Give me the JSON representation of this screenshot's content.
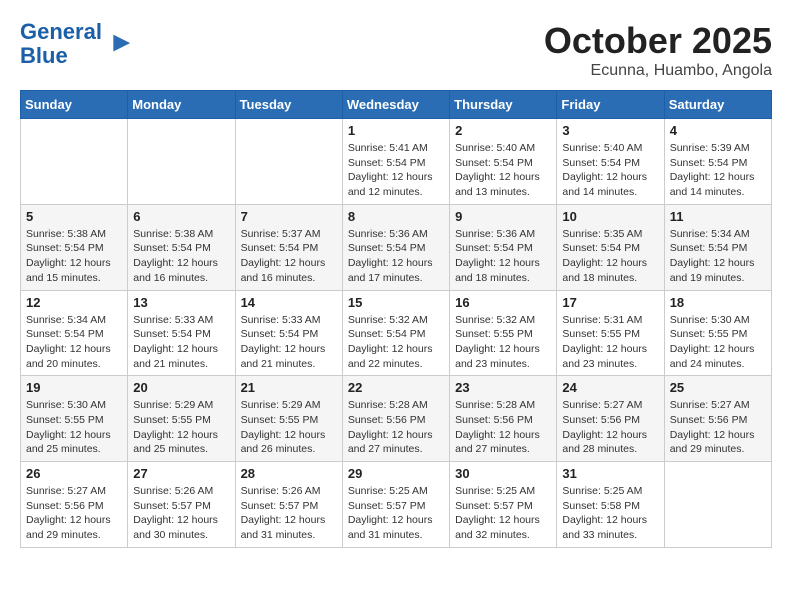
{
  "header": {
    "logo_line1": "General",
    "logo_line2": "Blue",
    "month": "October 2025",
    "location": "Ecunna, Huambo, Angola"
  },
  "weekdays": [
    "Sunday",
    "Monday",
    "Tuesday",
    "Wednesday",
    "Thursday",
    "Friday",
    "Saturday"
  ],
  "weeks": [
    [
      {
        "day": "",
        "info": ""
      },
      {
        "day": "",
        "info": ""
      },
      {
        "day": "",
        "info": ""
      },
      {
        "day": "1",
        "info": "Sunrise: 5:41 AM\nSunset: 5:54 PM\nDaylight: 12 hours and 12 minutes."
      },
      {
        "day": "2",
        "info": "Sunrise: 5:40 AM\nSunset: 5:54 PM\nDaylight: 12 hours and 13 minutes."
      },
      {
        "day": "3",
        "info": "Sunrise: 5:40 AM\nSunset: 5:54 PM\nDaylight: 12 hours and 14 minutes."
      },
      {
        "day": "4",
        "info": "Sunrise: 5:39 AM\nSunset: 5:54 PM\nDaylight: 12 hours and 14 minutes."
      }
    ],
    [
      {
        "day": "5",
        "info": "Sunrise: 5:38 AM\nSunset: 5:54 PM\nDaylight: 12 hours and 15 minutes."
      },
      {
        "day": "6",
        "info": "Sunrise: 5:38 AM\nSunset: 5:54 PM\nDaylight: 12 hours and 16 minutes."
      },
      {
        "day": "7",
        "info": "Sunrise: 5:37 AM\nSunset: 5:54 PM\nDaylight: 12 hours and 16 minutes."
      },
      {
        "day": "8",
        "info": "Sunrise: 5:36 AM\nSunset: 5:54 PM\nDaylight: 12 hours and 17 minutes."
      },
      {
        "day": "9",
        "info": "Sunrise: 5:36 AM\nSunset: 5:54 PM\nDaylight: 12 hours and 18 minutes."
      },
      {
        "day": "10",
        "info": "Sunrise: 5:35 AM\nSunset: 5:54 PM\nDaylight: 12 hours and 18 minutes."
      },
      {
        "day": "11",
        "info": "Sunrise: 5:34 AM\nSunset: 5:54 PM\nDaylight: 12 hours and 19 minutes."
      }
    ],
    [
      {
        "day": "12",
        "info": "Sunrise: 5:34 AM\nSunset: 5:54 PM\nDaylight: 12 hours and 20 minutes."
      },
      {
        "day": "13",
        "info": "Sunrise: 5:33 AM\nSunset: 5:54 PM\nDaylight: 12 hours and 21 minutes."
      },
      {
        "day": "14",
        "info": "Sunrise: 5:33 AM\nSunset: 5:54 PM\nDaylight: 12 hours and 21 minutes."
      },
      {
        "day": "15",
        "info": "Sunrise: 5:32 AM\nSunset: 5:54 PM\nDaylight: 12 hours and 22 minutes."
      },
      {
        "day": "16",
        "info": "Sunrise: 5:32 AM\nSunset: 5:55 PM\nDaylight: 12 hours and 23 minutes."
      },
      {
        "day": "17",
        "info": "Sunrise: 5:31 AM\nSunset: 5:55 PM\nDaylight: 12 hours and 23 minutes."
      },
      {
        "day": "18",
        "info": "Sunrise: 5:30 AM\nSunset: 5:55 PM\nDaylight: 12 hours and 24 minutes."
      }
    ],
    [
      {
        "day": "19",
        "info": "Sunrise: 5:30 AM\nSunset: 5:55 PM\nDaylight: 12 hours and 25 minutes."
      },
      {
        "day": "20",
        "info": "Sunrise: 5:29 AM\nSunset: 5:55 PM\nDaylight: 12 hours and 25 minutes."
      },
      {
        "day": "21",
        "info": "Sunrise: 5:29 AM\nSunset: 5:55 PM\nDaylight: 12 hours and 26 minutes."
      },
      {
        "day": "22",
        "info": "Sunrise: 5:28 AM\nSunset: 5:56 PM\nDaylight: 12 hours and 27 minutes."
      },
      {
        "day": "23",
        "info": "Sunrise: 5:28 AM\nSunset: 5:56 PM\nDaylight: 12 hours and 27 minutes."
      },
      {
        "day": "24",
        "info": "Sunrise: 5:27 AM\nSunset: 5:56 PM\nDaylight: 12 hours and 28 minutes."
      },
      {
        "day": "25",
        "info": "Sunrise: 5:27 AM\nSunset: 5:56 PM\nDaylight: 12 hours and 29 minutes."
      }
    ],
    [
      {
        "day": "26",
        "info": "Sunrise: 5:27 AM\nSunset: 5:56 PM\nDaylight: 12 hours and 29 minutes."
      },
      {
        "day": "27",
        "info": "Sunrise: 5:26 AM\nSunset: 5:57 PM\nDaylight: 12 hours and 30 minutes."
      },
      {
        "day": "28",
        "info": "Sunrise: 5:26 AM\nSunset: 5:57 PM\nDaylight: 12 hours and 31 minutes."
      },
      {
        "day": "29",
        "info": "Sunrise: 5:25 AM\nSunset: 5:57 PM\nDaylight: 12 hours and 31 minutes."
      },
      {
        "day": "30",
        "info": "Sunrise: 5:25 AM\nSunset: 5:57 PM\nDaylight: 12 hours and 32 minutes."
      },
      {
        "day": "31",
        "info": "Sunrise: 5:25 AM\nSunset: 5:58 PM\nDaylight: 12 hours and 33 minutes."
      },
      {
        "day": "",
        "info": ""
      }
    ]
  ]
}
